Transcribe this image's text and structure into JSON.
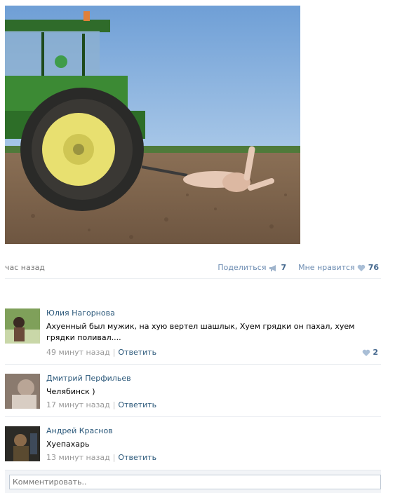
{
  "post": {
    "time": "час назад",
    "share_label": "Поделиться",
    "share_count": "7",
    "like_label": "Мне нравится",
    "like_count": "76"
  },
  "comments": [
    {
      "author": "Юлия Нагорнова",
      "text": "Ахуенный был мужик, на хую вертел шашлык, Хуем грядки он пахал, хуем грядки поливал....",
      "time": "49 минут назад",
      "reply": "Ответить",
      "likes": "2"
    },
    {
      "author": "Дмитрий Перфильев",
      "text": "Челябинск )",
      "time": "17 минут назад",
      "reply": "Ответить"
    },
    {
      "author": "Андрей Краснов",
      "text": "Хуепахарь",
      "time": "13 минут назад",
      "reply": "Ответить"
    }
  ],
  "comment_input": {
    "placeholder": "Комментировать.."
  },
  "icons": {
    "share": "megaphone-icon",
    "like": "heart-icon"
  },
  "colors": {
    "link": "#2b587a",
    "muted": "#777777",
    "action": "#6b8bb1"
  }
}
